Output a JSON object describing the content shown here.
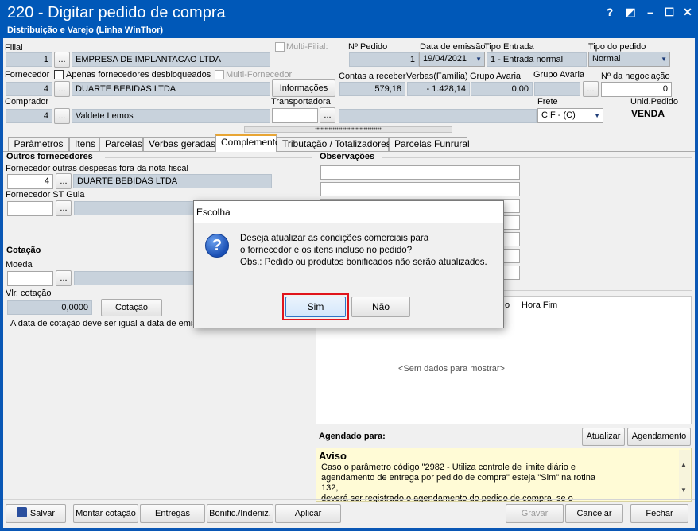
{
  "window": {
    "title": "220 - Digitar pedido de compra",
    "subtitle": "Distribuição e Varejo (Linha WinThor)",
    "controls": [
      "?",
      "◩",
      "–",
      "☐",
      "✕"
    ]
  },
  "header": {
    "filial_label": "Filial",
    "filial_code": "1",
    "filial_name": "EMPRESA DE IMPLANTACAO LTDA",
    "multi_filial_label": "Multi-Filial:",
    "pedido_label": "Nº Pedido",
    "pedido_value": "1",
    "emissao_label": "Data de emissão",
    "emissao_value": "19/04/2021",
    "tipo_entrada_label": "Tipo Entrada",
    "tipo_entrada_value": "1 - Entrada normal",
    "tipo_pedido_label": "Tipo do pedido",
    "tipo_pedido_value": "Normal",
    "fornecedor_label": "Fornecedor",
    "apenas_label": "Apenas fornecedores desbloqueados",
    "multi_fornecedor_label": "Multi-Fornecedor",
    "fornecedor_code": "4",
    "fornecedor_name": "DUARTE BEBIDAS LTDA",
    "informacoes_label": "Informações",
    "contas_label": "Contas a receber",
    "contas_value": "579,18",
    "verbas_label": "Verbas(Família)",
    "verbas_value": "- 1.428,14",
    "grupo_avaria_label": "Grupo Avaria",
    "grupo_avaria_value": "0,00",
    "grupo_avaria2_label": "Grupo Avaria",
    "negociacao_label": "Nº da negociação",
    "negociacao_value": "0",
    "comprador_label": "Comprador",
    "comprador_code": "4",
    "comprador_name": "Valdete Lemos",
    "transportadora_label": "Transportadora",
    "frete_label": "Frete",
    "frete_value": "CIF - (C)",
    "unid_label": "Unid.Pedido",
    "unid_value": "VENDA",
    "dots_label": "...",
    "splitter": "••••••••••••••••••••••••••••••••••"
  },
  "tabs": [
    "Parâmetros",
    "Itens",
    "Parcelas",
    "Verbas geradas",
    "Complemento",
    "Tributação / Totalizadores",
    "Parcelas Funrural"
  ],
  "left_panel": {
    "outros_title": "Outros fornecedores",
    "despesas_label": "Fornecedor outras despesas fora da nota fiscal",
    "despesas_code": "4",
    "despesas_name": "DUARTE BEBIDAS LTDA",
    "st_guia_label": "Fornecedor ST Guia",
    "cotacao_title": "Cotação",
    "moeda_label": "Moeda",
    "vlr_cotacao_label": "Vlr. cotação",
    "vlr_cotacao_value": "0,0000",
    "cotacao_button": "Cotação",
    "cotacao_note": "A data de cotação deve ser igual a data de emissão"
  },
  "right_panel": {
    "observacoes_title": "Observações",
    "grid_col_partial": "o",
    "grid_col_hora_fim": "Hora Fim",
    "grid_empty": "<Sem dados para mostrar>",
    "agendado_label": "Agendado para:",
    "atualizar_button": "Atualizar",
    "agendamento_button": "Agendamento",
    "aviso_title": "Aviso",
    "aviso_lines": [
      "Caso o parâmetro código \"2982 - Utiliza controle de limite diário e",
      "agendamento de entrega por pedido de compra\" esteja \"Sim\" na rotina",
      "132,",
      "deverá ser registrado o agendamento do pedido de compra, se o"
    ]
  },
  "footer": {
    "salvar": "Salvar",
    "montar": "Montar cotação",
    "entregas": "Entregas",
    "bonific": "Bonific./Indeniz.",
    "aplicar": "Aplicar",
    "gravar": "Gravar",
    "cancelar": "Cancelar",
    "fechar": "Fechar"
  },
  "dialog": {
    "title": "Escolha",
    "line1": "Deseja atualizar as condições comerciais para",
    "line2": "o fornecedor e os itens incluso no pedido?",
    "line3": "Obs.: Pedido ou produtos bonificados não serão atualizados.",
    "sim": "Sim",
    "nao": "Não"
  },
  "colors": {
    "title_bar": "#0058b8",
    "readonly_field": "#c8d2dc",
    "highlight": "#e0141c",
    "aviso_bg": "#fffbd6"
  }
}
